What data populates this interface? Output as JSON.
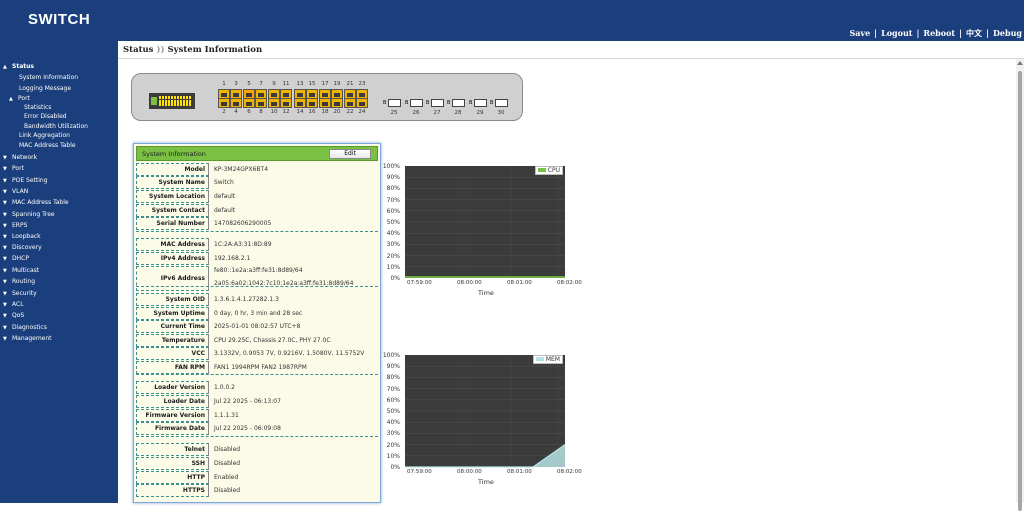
{
  "brand": "SWITCH",
  "topnav": {
    "save": "Save",
    "logout": "Logout",
    "reboot": "Reboot",
    "lang": "中文",
    "debug": "Debug",
    "sep": "|"
  },
  "sidebar": [
    {
      "label": "Status",
      "arrow": "▲"
    },
    {
      "label": "System Information",
      "arrow": ""
    },
    {
      "label": "Logging Message",
      "arrow": ""
    },
    {
      "label": "Port",
      "arrow": "▲"
    },
    {
      "label": "Statistics",
      "arrow": ""
    },
    {
      "label": "Error Disabled",
      "arrow": ""
    },
    {
      "label": "Bandwidth Utilization",
      "arrow": ""
    },
    {
      "label": "Link Aggregation",
      "arrow": ""
    },
    {
      "label": "MAC Address Table",
      "arrow": ""
    },
    {
      "label": "Network",
      "arrow": "▼"
    },
    {
      "label": "Port",
      "arrow": "▼"
    },
    {
      "label": "POE Setting",
      "arrow": "▼"
    },
    {
      "label": "VLAN",
      "arrow": "▼"
    },
    {
      "label": "MAC Address Table",
      "arrow": "▼"
    },
    {
      "label": "Spanning Tree",
      "arrow": "▼"
    },
    {
      "label": "ERPS",
      "arrow": "▼"
    },
    {
      "label": "Loopback",
      "arrow": "▼"
    },
    {
      "label": "Discovery",
      "arrow": "▼"
    },
    {
      "label": "DHCP",
      "arrow": "▼"
    },
    {
      "label": "Multicast",
      "arrow": "▼"
    },
    {
      "label": "Routing",
      "arrow": "▼"
    },
    {
      "label": "Security",
      "arrow": "▼"
    },
    {
      "label": "ACL",
      "arrow": "▼"
    },
    {
      "label": "QoS",
      "arrow": "▼"
    },
    {
      "label": "Diagnostics",
      "arrow": "▼"
    },
    {
      "label": "Management",
      "arrow": "▼"
    }
  ],
  "breadcrumb": {
    "parent": "Status",
    "sep": "))",
    "current": "System Information"
  },
  "ports": {
    "top": [
      "1",
      "3",
      "5",
      "7",
      "9",
      "11",
      "13",
      "15",
      "17",
      "19",
      "21",
      "23"
    ],
    "bottom": [
      "2",
      "4",
      "6",
      "8",
      "10",
      "12",
      "14",
      "16",
      "18",
      "20",
      "22",
      "24"
    ],
    "sfp": [
      "25",
      "26",
      "27",
      "28",
      "29",
      "30"
    ],
    "sfp_label": "B"
  },
  "sysinfo": {
    "title": "System Information",
    "edit": "Edit",
    "rows": [
      {
        "label": "Model",
        "value": "KP-3M24GPX6BT4"
      },
      {
        "label": "System Name",
        "value": "Switch"
      },
      {
        "label": "System Location",
        "value": "default"
      },
      {
        "label": "System Contact",
        "value": "default"
      },
      {
        "label": "Serial Number",
        "value": "147082606290005"
      },
      {
        "label": "MAC Address",
        "value": "1C:2A:A3:31:8D:89"
      },
      {
        "label": "IPv4 Address",
        "value": "192.168.2.1"
      },
      {
        "label": "IPv6 Address",
        "value": "fe80::1e2a:a3ff:fe31:8d89/64",
        "value2": "2a05:6a02:1042:7c10:1e2a:a3ff:fe31:8d89/64"
      },
      {
        "label": "System OID",
        "value": "1.3.6.1.4.1.27282.1.3"
      },
      {
        "label": "System Uptime",
        "value": "0 day, 0 hr, 3 min and 28 sec"
      },
      {
        "label": "Current Time",
        "value": "2025-01-01 08:02:57 UTC+8"
      },
      {
        "label": "Temperature",
        "value": "CPU 29.25C, Chassis 27.0C, PHY 27.0C"
      },
      {
        "label": "VCC",
        "value": "3.1332V, 0.9053 7V, 0.9216V, 1.5080V, 11.5752V"
      },
      {
        "label": "FAN RPM",
        "value": "FAN1 1994RPM  FAN2 1987RPM"
      },
      {
        "label": "Loader Version",
        "value": "1.0.0.2"
      },
      {
        "label": "Loader Date",
        "value": "Jul 22 2025 - 06:13:07"
      },
      {
        "label": "Firmware Version",
        "value": "1.1.1.31"
      },
      {
        "label": "Firmware Date",
        "value": "Jul 22 2025 - 06:09:08"
      },
      {
        "label": "Telnet",
        "value": "Disabled"
      },
      {
        "label": "SSH",
        "value": "Disabled"
      },
      {
        "label": "HTTP",
        "value": "Enabled"
      },
      {
        "label": "HTTPS",
        "value": "Disabled"
      }
    ]
  },
  "charts": {
    "cpu": {
      "legend": "CPU",
      "color": "#7ac143",
      "xlabel": "Time",
      "yticks": [
        "100%",
        "90%",
        "80%",
        "70%",
        "60%",
        "50%",
        "40%",
        "30%",
        "20%",
        "10%",
        "0%"
      ],
      "xticks": [
        "07:59:00",
        "08:00:00",
        "08:01:00",
        "08:02:00"
      ],
      "values": [
        1,
        1,
        1,
        1,
        1,
        1
      ]
    },
    "mem": {
      "legend": "MEM",
      "color": "#b7e3e4",
      "xlabel": "Time",
      "yticks": [
        "100%",
        "90%",
        "80%",
        "70%",
        "60%",
        "50%",
        "40%",
        "30%",
        "20%",
        "10%",
        "0%"
      ],
      "xticks": [
        "07:59:00",
        "08:00:00",
        "08:01:00",
        "08:02:00"
      ],
      "values": [
        0,
        0,
        0,
        0,
        0,
        20
      ]
    }
  }
}
